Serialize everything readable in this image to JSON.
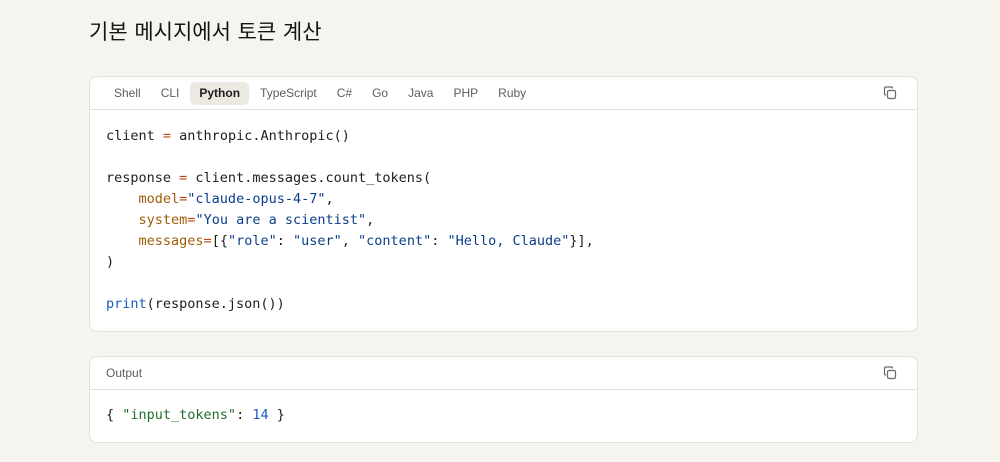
{
  "page": {
    "title": "기본 메시지에서 토큰 계산"
  },
  "code_panel": {
    "tabs": [
      {
        "label": "Shell",
        "active": false
      },
      {
        "label": "CLI",
        "active": false
      },
      {
        "label": "Python",
        "active": true
      },
      {
        "label": "TypeScript",
        "active": false
      },
      {
        "label": "C#",
        "active": false
      },
      {
        "label": "Go",
        "active": false
      },
      {
        "label": "Java",
        "active": false
      },
      {
        "label": "PHP",
        "active": false
      },
      {
        "label": "Ruby",
        "active": false
      }
    ],
    "copy_icon": "copy-icon",
    "code": {
      "l1_a": "client ",
      "l1_op": "=",
      "l1_b": " anthropic.Anthropic()",
      "l3_a": "response ",
      "l3_op": "=",
      "l3_b": " client.messages.count_tokens(",
      "l4_indent": "    ",
      "l4_kw": "model",
      "l4_eq": "=",
      "l4_str": "\"claude-opus-4-7\"",
      "l4_end": ",",
      "l5_indent": "    ",
      "l5_kw": "system",
      "l5_eq": "=",
      "l5_str": "\"You are a scientist\"",
      "l5_end": ",",
      "l6_indent": "    ",
      "l6_kw": "messages",
      "l6_eq": "=",
      "l6_open": "[{",
      "l6_s1": "\"role\"",
      "l6_c1": ": ",
      "l6_s2": "\"user\"",
      "l6_c2": ", ",
      "l6_s3": "\"content\"",
      "l6_c3": ": ",
      "l6_s4": "\"Hello, Claude\"",
      "l6_close": "}],",
      "l7": ")",
      "l9_fn": "print",
      "l9_rest": "(response.json())"
    }
  },
  "output_panel": {
    "label": "Output",
    "copy_icon": "copy-icon",
    "output": {
      "open": "{ ",
      "key": "\"input_tokens\"",
      "colon": ": ",
      "value": "14",
      "close": " }"
    }
  },
  "colors": {
    "background": "#f5f4ef",
    "panel": "#ffffff",
    "border": "#e3e1da",
    "operator": "#c2410c",
    "keyword": "#a15c05",
    "string": "#0b3e8a",
    "function": "#1d5bbf",
    "output_string": "#1f6f2a"
  }
}
